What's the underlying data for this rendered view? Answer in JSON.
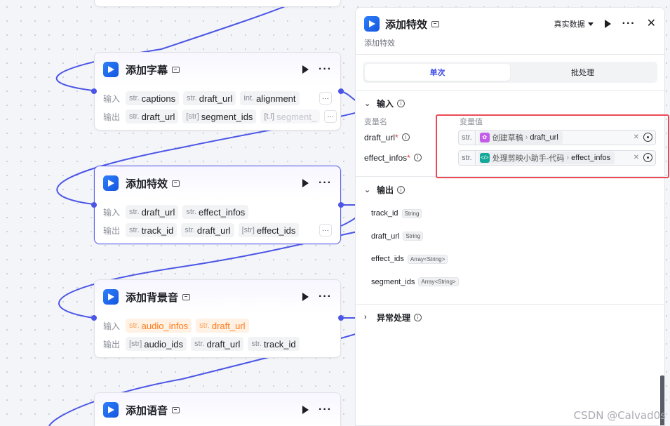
{
  "nodes": {
    "subtitle": {
      "title": "添加字幕",
      "input_label": "输入",
      "output_label": "输出",
      "inputs": [
        {
          "type": "str.",
          "name": "captions"
        },
        {
          "type": "str.",
          "name": "draft_url"
        },
        {
          "type": "int.",
          "name": "alignment"
        }
      ],
      "outputs": [
        {
          "type": "str.",
          "name": "draft_url"
        },
        {
          "type": "[str]",
          "name": "segment_ids"
        },
        {
          "type": "[t.l]",
          "name": "segment_"
        }
      ]
    },
    "effect": {
      "title": "添加特效",
      "input_label": "输入",
      "output_label": "输出",
      "inputs": [
        {
          "type": "str.",
          "name": "draft_url"
        },
        {
          "type": "str.",
          "name": "effect_infos"
        }
      ],
      "outputs": [
        {
          "type": "str.",
          "name": "track_id"
        },
        {
          "type": "str.",
          "name": "draft_url"
        },
        {
          "type": "[str]",
          "name": "effect_ids"
        }
      ]
    },
    "bgm": {
      "title": "添加背景音",
      "input_label": "输入",
      "output_label": "输出",
      "inputs": [
        {
          "type": "str.",
          "name": "audio_infos"
        },
        {
          "type": "str.",
          "name": "draft_url"
        }
      ],
      "outputs": [
        {
          "type": "[str]",
          "name": "audio_ids"
        },
        {
          "type": "str.",
          "name": "draft_url"
        },
        {
          "type": "str.",
          "name": "track_id"
        }
      ]
    },
    "voice": {
      "title": "添加语音"
    }
  },
  "panel": {
    "title": "添加特效",
    "subtitle": "添加特效",
    "data_mode": "真实数据",
    "tabs": [
      "单次",
      "批处理"
    ],
    "input_section": "输入",
    "col_name": "变量名",
    "col_value": "变量值",
    "variables": [
      {
        "name": "draft_url",
        "type": "str.",
        "source": "创建草稿",
        "field": "draft_url",
        "icon_color": "#c35ce8"
      },
      {
        "name": "effect_infos",
        "type": "str.",
        "source": "处理剪映小助手-代码",
        "field": "effect_infos",
        "icon_color": "#14a89a"
      }
    ],
    "output_section": "输出",
    "outputs": [
      {
        "name": "track_id",
        "type": "String"
      },
      {
        "name": "draft_url",
        "type": "String"
      },
      {
        "name": "effect_ids",
        "type": "Array<String>"
      },
      {
        "name": "segment_ids",
        "type": "Array<String>"
      }
    ],
    "error_section": "异常处理",
    "required_mark": "*"
  },
  "colors": {
    "accent": "#4b56e6",
    "highlight": "#ee4a55",
    "warn": "#ff7a1a"
  },
  "watermark": "CSDN @Calvad0s"
}
